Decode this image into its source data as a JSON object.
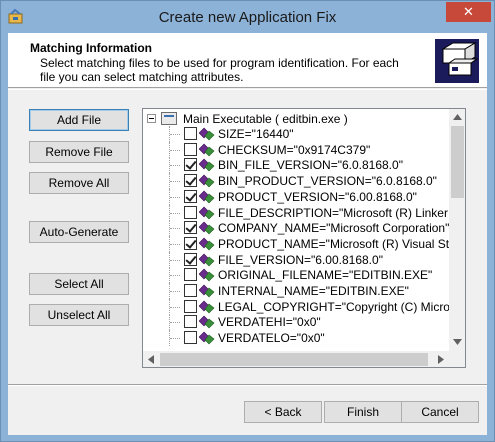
{
  "window": {
    "title": "Create new Application Fix",
    "close_glyph": "✕"
  },
  "header": {
    "title": "Matching Information",
    "description": "Select matching files to be used for program identification. For each file you can select matching attributes."
  },
  "buttons": {
    "add_file": "Add File",
    "remove_file": "Remove File",
    "remove_all": "Remove All",
    "auto_generate": "Auto-Generate",
    "select_all": "Select All",
    "unselect_all": "Unselect All",
    "back": "< Back",
    "finish": "Finish",
    "cancel": "Cancel"
  },
  "tree": {
    "root_label": "Main Executable ( editbin.exe )",
    "items": [
      {
        "label": "SIZE=\"16440\"",
        "checked": false
      },
      {
        "label": "CHECKSUM=\"0x9174C379\"",
        "checked": false
      },
      {
        "label": "BIN_FILE_VERSION=\"6.0.8168.0\"",
        "checked": true
      },
      {
        "label": "BIN_PRODUCT_VERSION=\"6.0.8168.0\"",
        "checked": true
      },
      {
        "label": "PRODUCT_VERSION=\"6.00.8168.0\"",
        "checked": true
      },
      {
        "label": "FILE_DESCRIPTION=\"Microsoft (R) Linker Stub\"",
        "checked": false
      },
      {
        "label": "COMPANY_NAME=\"Microsoft Corporation\"",
        "checked": true
      },
      {
        "label": "PRODUCT_NAME=\"Microsoft (R) Visual Studio\"",
        "checked": true
      },
      {
        "label": "FILE_VERSION=\"6.00.8168.0\"",
        "checked": true
      },
      {
        "label": "ORIGINAL_FILENAME=\"EDITBIN.EXE\"",
        "checked": false
      },
      {
        "label": "INTERNAL_NAME=\"EDITBIN.EXE\"",
        "checked": false
      },
      {
        "label": "LEGAL_COPYRIGHT=\"Copyright (C) Microsoft Co",
        "checked": false
      },
      {
        "label": "VERDATEHI=\"0x0\"",
        "checked": false
      },
      {
        "label": "VERDATELO=\"0x0\"",
        "checked": false
      }
    ]
  },
  "colors": {
    "title_bar": "#8db2d8",
    "close_button": "#c7493a",
    "attribute_icon": "#6a2c8c"
  }
}
